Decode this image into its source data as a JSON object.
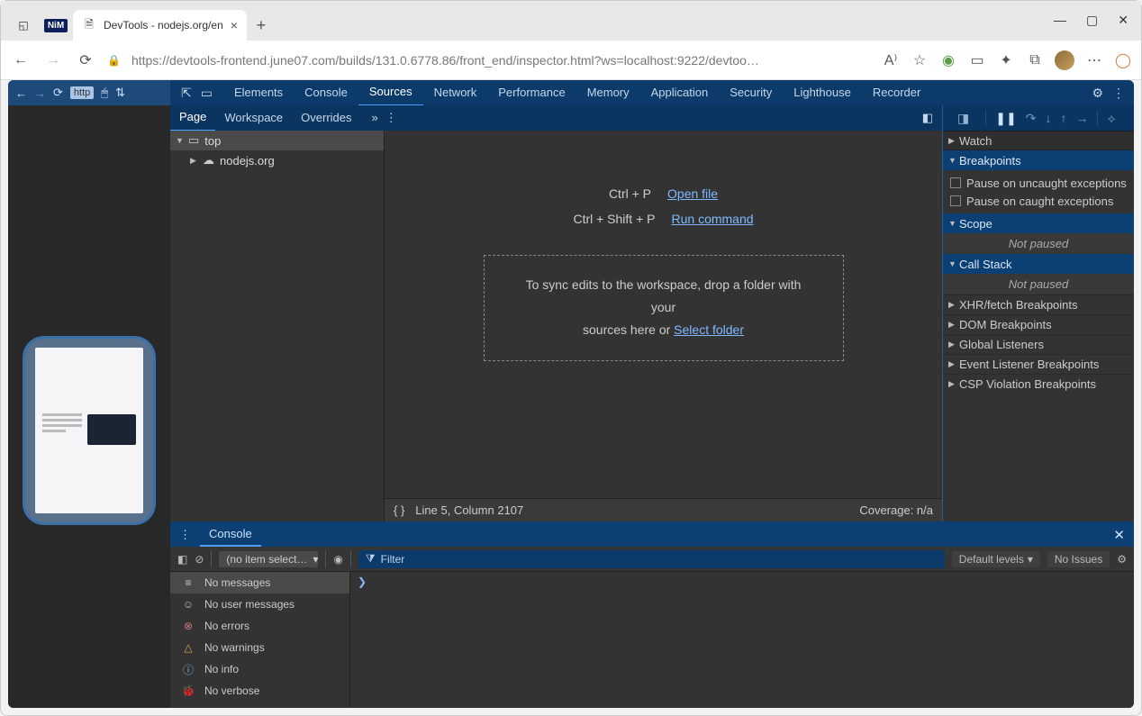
{
  "browser": {
    "pinned_tab_label": "NiM",
    "active_tab_title": "DevTools - nodejs.org/en",
    "url": "https://devtools-frontend.june07.com/builds/131.0.6778.86/front_end/inspector.html?ws=localhost:9222/devtoo…"
  },
  "inner_nav": {
    "http_label": "http"
  },
  "devtools_tabs": [
    "Elements",
    "Console",
    "Sources",
    "Network",
    "Performance",
    "Memory",
    "Application",
    "Security",
    "Lighthouse",
    "Recorder"
  ],
  "devtools_active_tab": "Sources",
  "subtabs": {
    "page": "Page",
    "workspace": "Workspace",
    "overrides": "Overrides"
  },
  "tree": {
    "top": "top",
    "site": "nodejs.org"
  },
  "editor": {
    "openfile_kb": "Ctrl + P",
    "openfile_link": "Open file",
    "runcmd_kb": "Ctrl + Shift + P",
    "runcmd_link": "Run command",
    "drop_text_a": "To sync edits to the workspace, drop a folder with your",
    "drop_text_b": "sources here or ",
    "select_folder": "Select folder",
    "footer_pos": "Line 5, Column 2107",
    "coverage": "Coverage: n/a"
  },
  "right": {
    "watch": "Watch",
    "breakpoints": "Breakpoints",
    "pause_uncaught": "Pause on uncaught exceptions",
    "pause_caught": "Pause on caught exceptions",
    "scope": "Scope",
    "not_paused": "Not paused",
    "call_stack": "Call Stack",
    "xhr": "XHR/fetch Breakpoints",
    "dom": "DOM Breakpoints",
    "globals": "Global Listeners",
    "evt": "Event Listener Breakpoints",
    "csp": "CSP Violation Breakpoints"
  },
  "drawer": {
    "tab": "Console",
    "context": "(no item select…",
    "filter_placeholder": "Filter",
    "levels": "Default levels",
    "issues": "No Issues",
    "msgs": {
      "none": "No messages",
      "user": "No user messages",
      "err": "No errors",
      "warn": "No warnings",
      "info": "No info",
      "verbose": "No verbose"
    },
    "prompt": "❯"
  }
}
